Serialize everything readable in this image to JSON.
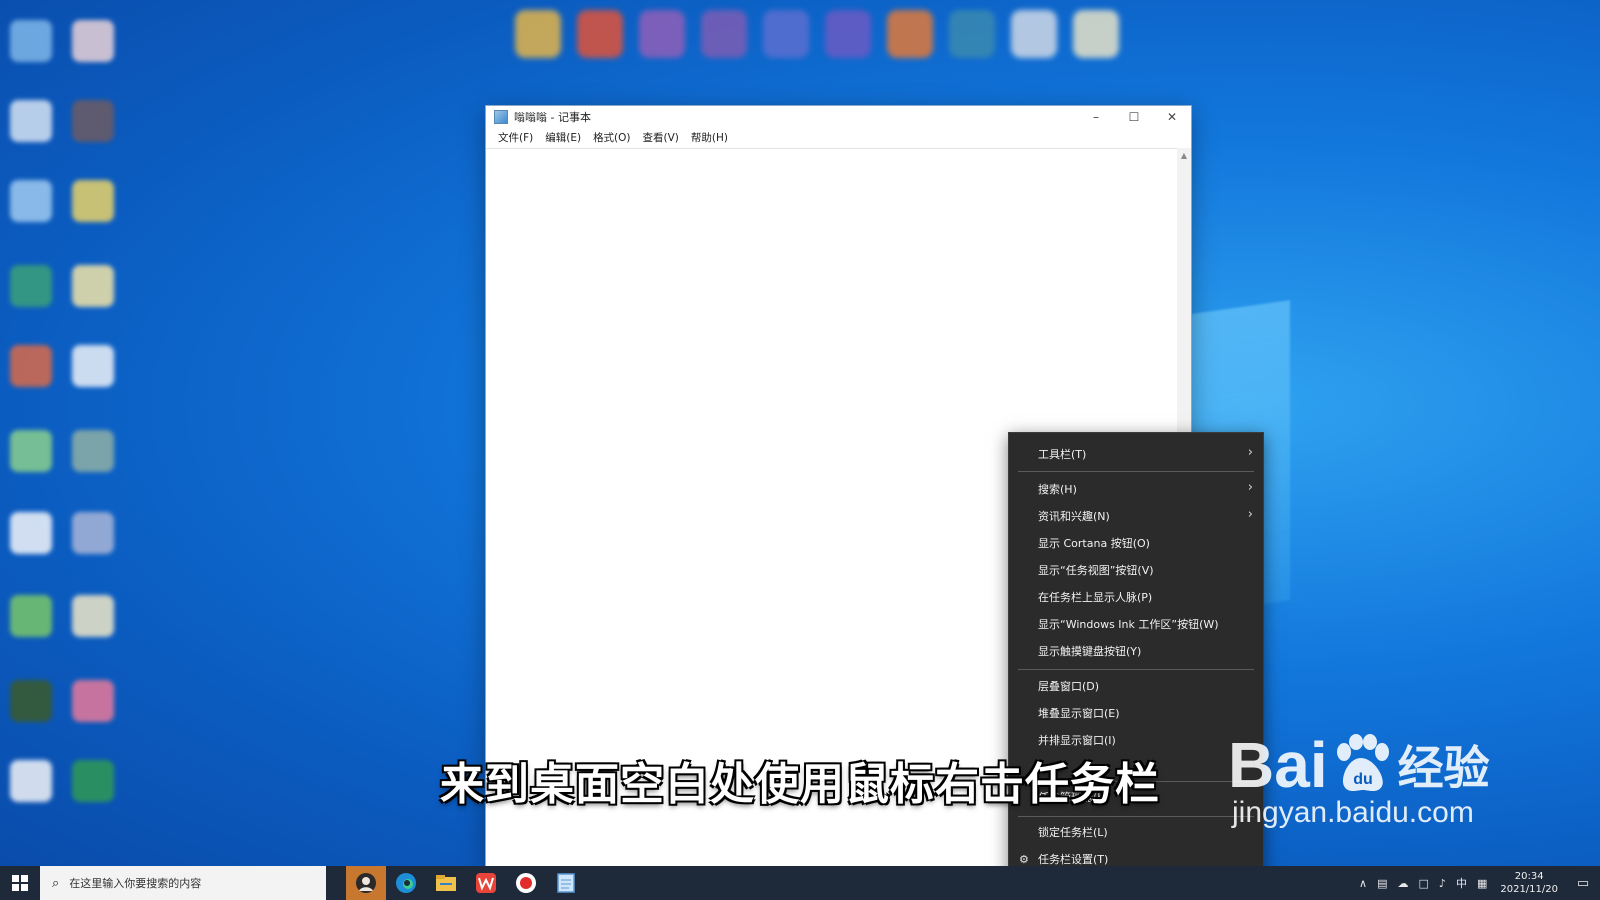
{
  "notepad": {
    "title": "嗡嗡嗡 - 记事本",
    "menu": [
      "文件(F)",
      "编辑(E)",
      "格式(O)",
      "查看(V)",
      "帮助(H)"
    ]
  },
  "context_menu": {
    "items": [
      {
        "label": "工具栏(T)",
        "submenu": true
      },
      {
        "label": "搜索(H)",
        "submenu": true
      },
      {
        "label": "资讯和兴趣(N)",
        "submenu": true
      },
      {
        "label": "显示 Cortana 按钮(O)"
      },
      {
        "label": "显示“任务视图”按钮(V)"
      },
      {
        "label": "在任务栏上显示人脉(P)"
      },
      {
        "label": "显示“Windows Ink 工作区”按钮(W)"
      },
      {
        "label": "显示触摸键盘按钮(Y)"
      },
      {
        "label": "层叠窗口(D)"
      },
      {
        "label": "堆叠显示窗口(E)"
      },
      {
        "label": "并排显示窗口(I)"
      },
      {
        "label": "任务管理器(K)"
      },
      {
        "label": "锁定任务栏(L)"
      },
      {
        "label": "任务栏设置(T)",
        "icon": "gear-icon"
      }
    ]
  },
  "subtitle": "来到桌面空白处使用鼠标右击任务栏",
  "watermark": {
    "brand_en": "Bai",
    "brand_du": "du",
    "brand_cn": "经验",
    "url": "jingyan.baidu.com"
  },
  "taskbar": {
    "search_placeholder": "在这里输入你要搜索的内容",
    "apps": [
      "avatar-app-icon",
      "edge-icon",
      "file-explorer-icon",
      "wps-icon",
      "record-icon",
      "notepad-icon"
    ],
    "tray": {
      "ime": "中",
      "time": "20:34",
      "date": "2021/11/20"
    }
  },
  "colors": {
    "taskbar": "#1e2a3a",
    "menu_bg": "#2b2b2b",
    "desktop": "#1277dc",
    "active_app": "#c8782e"
  }
}
